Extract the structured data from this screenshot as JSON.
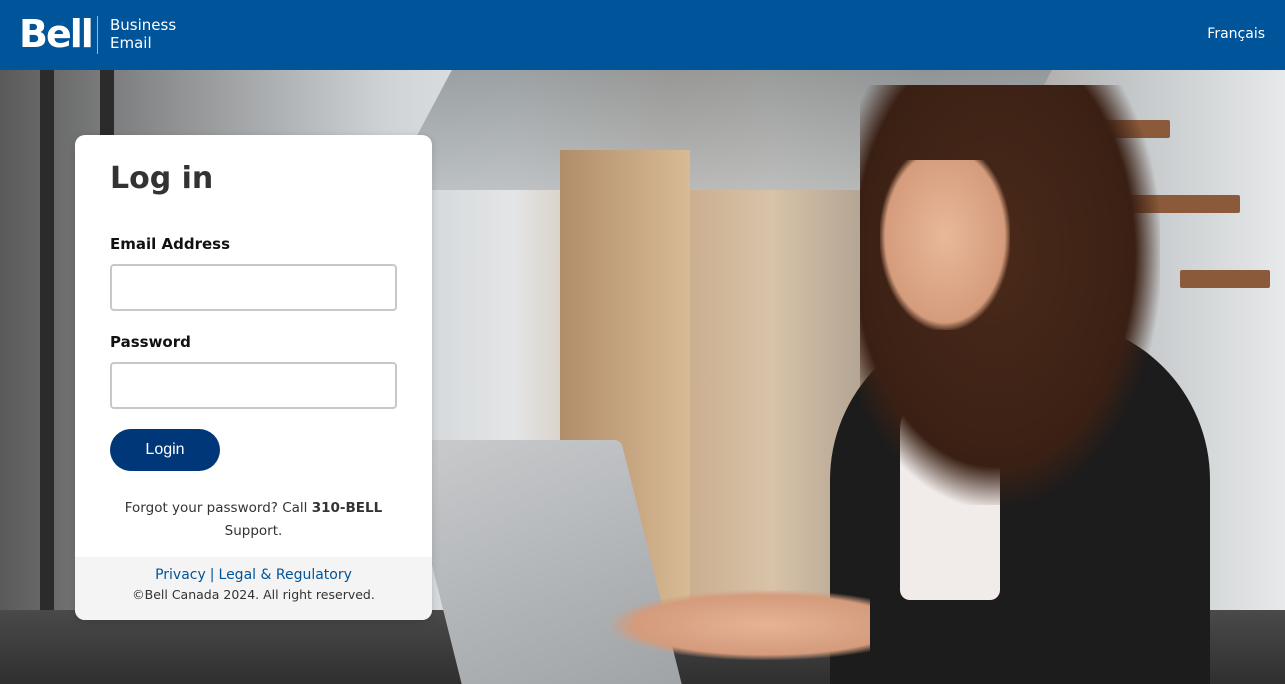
{
  "header": {
    "logo_text": "Bell",
    "product_line1": "Business",
    "product_line2": "Email",
    "language_link": "Français",
    "background_color": "#00549a"
  },
  "login": {
    "title": "Log in",
    "email_label": "Email Address",
    "email_value": "",
    "email_placeholder": "",
    "password_label": "Password",
    "password_value": "",
    "password_placeholder": "",
    "login_button": "Login",
    "button_color": "#003778",
    "help_prefix": "Forgot your password? Call ",
    "help_number": "310-BELL",
    "help_suffix": "Support."
  },
  "footer": {
    "privacy_link": "Privacy",
    "separator": "|",
    "legal_link": "Legal & Regulatory",
    "copyright": "©Bell Canada 2024. All right reserved.",
    "link_color": "#00549a"
  }
}
